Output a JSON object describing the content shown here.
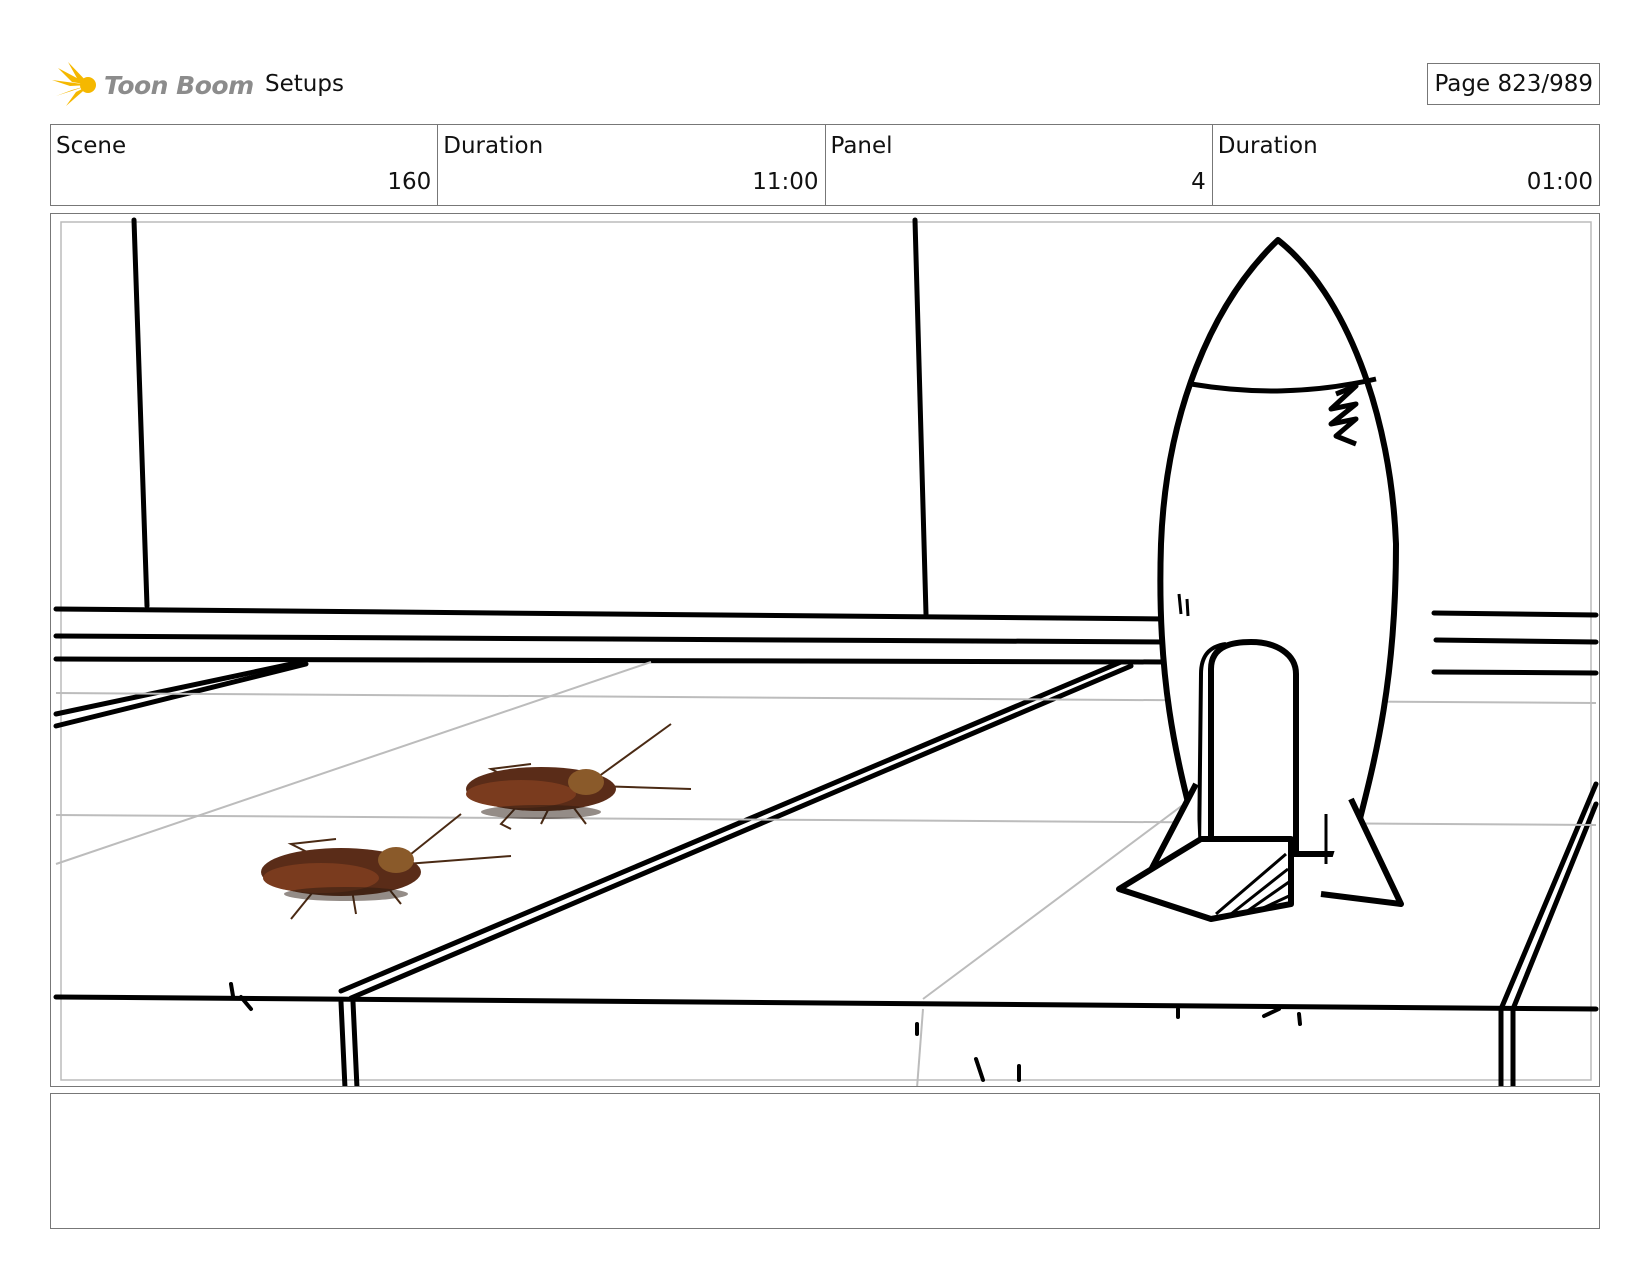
{
  "header": {
    "brand": "Toon Boom",
    "section": "Setups",
    "page_label": "Page 823/989"
  },
  "info": [
    {
      "label": "Scene",
      "value": "160"
    },
    {
      "label": "Duration",
      "value": "11:00"
    },
    {
      "label": "Panel",
      "value": "4"
    },
    {
      "label": "Duration",
      "value": "01:00"
    }
  ],
  "panel": {
    "description_icons": [
      "rocket-sketch",
      "cockroach",
      "cockroach"
    ]
  },
  "notes": {
    "text": ""
  },
  "colors": {
    "logo_yellow": "#f5b800",
    "border": "#777777",
    "cockroach": "#5a2c18"
  }
}
